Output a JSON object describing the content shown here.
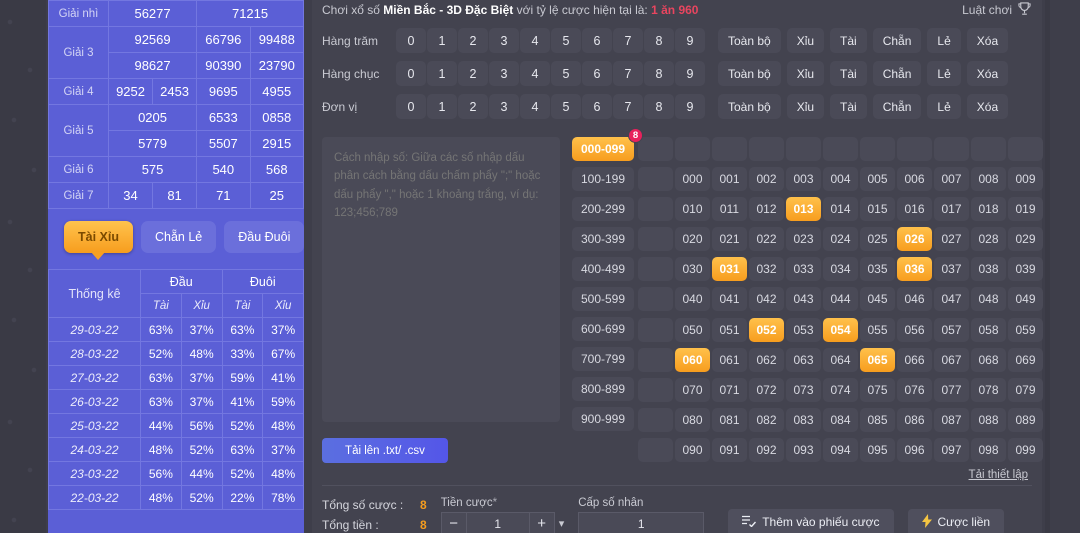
{
  "lottery_results": {
    "rows": [
      {
        "label": "Giải nhì",
        "cells": [
          {
            "t": "56277",
            "span": 2
          },
          {
            "t": "71215",
            "span": 2
          }
        ]
      },
      {
        "label": "Giải 3",
        "label_rowspan": 2,
        "cells": [
          {
            "t": "92569",
            "span": 2
          },
          {
            "t": "66796",
            "span": 1
          },
          {
            "t": "99488",
            "span": 1
          }
        ]
      },
      {
        "label": "",
        "cells": [
          {
            "t": "98627",
            "span": 2
          },
          {
            "t": "90390",
            "span": 1
          },
          {
            "t": "23790",
            "span": 1
          }
        ]
      },
      {
        "label": "Giải 4",
        "cells": [
          {
            "t": "9252",
            "span": 1
          },
          {
            "t": "2453",
            "span": 1
          },
          {
            "t": "9695",
            "span": 1
          },
          {
            "t": "4955",
            "span": 1
          }
        ]
      },
      {
        "label": "Giải 5",
        "label_rowspan": 2,
        "cells": [
          {
            "t": "0205",
            "span": 2
          },
          {
            "t": "6533",
            "span": 1
          },
          {
            "t": "0858",
            "span": 1
          }
        ]
      },
      {
        "label": "",
        "cells": [
          {
            "t": "5779",
            "span": 2
          },
          {
            "t": "5507",
            "span": 1
          },
          {
            "t": "2915",
            "span": 1
          }
        ]
      },
      {
        "label": "Giải 6",
        "cells": [
          {
            "t": "575",
            "span": 2
          },
          {
            "t": "540",
            "span": 1
          },
          {
            "t": "568",
            "span": 1
          }
        ]
      },
      {
        "label": "Giải 7",
        "cells": [
          {
            "t": "34",
            "span": 1
          },
          {
            "t": "81",
            "span": 1
          },
          {
            "t": "71",
            "span": 1
          },
          {
            "t": "25",
            "span": 1
          }
        ]
      }
    ]
  },
  "bet_tabs": [
    {
      "label": "Tài Xỉu",
      "active": true
    },
    {
      "label": "Chẵn Lẻ",
      "active": false
    },
    {
      "label": "Đầu Đuôi",
      "active": false
    }
  ],
  "stats": {
    "corner_label": "Thống kê",
    "group_headers": [
      "Đầu",
      "Đuôi"
    ],
    "sub_headers": [
      "Tài",
      "Xỉu",
      "Tài",
      "Xỉu"
    ],
    "rows": [
      {
        "date": "29-03-22",
        "values": [
          "63%",
          "37%",
          "63%",
          "37%"
        ]
      },
      {
        "date": "28-03-22",
        "values": [
          "52%",
          "48%",
          "33%",
          "67%"
        ]
      },
      {
        "date": "27-03-22",
        "values": [
          "63%",
          "37%",
          "59%",
          "41%"
        ]
      },
      {
        "date": "26-03-22",
        "values": [
          "63%",
          "37%",
          "41%",
          "59%"
        ]
      },
      {
        "date": "25-03-22",
        "values": [
          "44%",
          "56%",
          "52%",
          "48%"
        ]
      },
      {
        "date": "24-03-22",
        "values": [
          "48%",
          "52%",
          "63%",
          "37%"
        ]
      },
      {
        "date": "23-03-22",
        "values": [
          "56%",
          "44%",
          "52%",
          "48%"
        ]
      },
      {
        "date": "22-03-22",
        "values": [
          "48%",
          "52%",
          "22%",
          "78%"
        ]
      }
    ]
  },
  "header": {
    "prefix": "Chơi xổ số ",
    "game_name": "Miền Bắc - 3D Đặc Biệt",
    "middle": " với tỷ lệ cược hiện tại là: ",
    "odds": "1 ăn 960",
    "rules_label": "Luật chơi",
    "rules_icon": "trophy-icon"
  },
  "digit_rows": [
    {
      "label": "Hàng trăm",
      "digits": [
        "0",
        "1",
        "2",
        "3",
        "4",
        "5",
        "6",
        "7",
        "8",
        "9"
      ],
      "quick": [
        "Toàn bộ",
        "Xỉu",
        "Tài",
        "Chẵn",
        "Lẻ",
        "Xóa"
      ]
    },
    {
      "label": "Hàng chục",
      "digits": [
        "0",
        "1",
        "2",
        "3",
        "4",
        "5",
        "6",
        "7",
        "8",
        "9"
      ],
      "quick": [
        "Toàn bộ",
        "Xỉu",
        "Tài",
        "Chẵn",
        "Lẻ",
        "Xóa"
      ]
    },
    {
      "label": "Đơn vị",
      "digits": [
        "0",
        "1",
        "2",
        "3",
        "4",
        "5",
        "6",
        "7",
        "8",
        "9"
      ],
      "quick": [
        "Toàn bộ",
        "Xỉu",
        "Tài",
        "Chẵn",
        "Lẻ",
        "Xóa"
      ]
    }
  ],
  "bet_input": {
    "value": "",
    "placeholder": "Cách nhập số: Giữa các số nhập dấu phân cách bằng dấu chấm phẩy \";\" hoặc dấu phẩy \",\" hoặc 1 khoảng trắng, ví dụ: 123;456;789",
    "upload_label": "Tải lên .txt/ .csv"
  },
  "number_grid": {
    "range_tabs": [
      {
        "label": "000-099",
        "active": true,
        "badge": "8"
      },
      {
        "label": "100-199",
        "active": false,
        "badge": ""
      },
      {
        "label": "200-299",
        "active": false,
        "badge": ""
      },
      {
        "label": "300-399",
        "active": false,
        "badge": ""
      },
      {
        "label": "400-499",
        "active": false,
        "badge": ""
      },
      {
        "label": "500-599",
        "active": false,
        "badge": ""
      },
      {
        "label": "600-699",
        "active": false,
        "badge": ""
      },
      {
        "label": "700-799",
        "active": false,
        "badge": ""
      },
      {
        "label": "800-899",
        "active": false,
        "badge": ""
      },
      {
        "label": "900-999",
        "active": false,
        "badge": ""
      }
    ],
    "rows": [
      {
        "cells": [
          "",
          "",
          "",
          "",
          "",
          "",
          "",
          "",
          "",
          "",
          ""
        ]
      },
      {
        "cells": [
          "",
          "000",
          "001",
          "002",
          "003",
          "004",
          "005",
          "006",
          "007",
          "008",
          "009"
        ]
      },
      {
        "cells": [
          "",
          "010",
          "011",
          "012",
          "013",
          "014",
          "015",
          "016",
          "017",
          "018",
          "019"
        ]
      },
      {
        "cells": [
          "",
          "020",
          "021",
          "022",
          "023",
          "024",
          "025",
          "026",
          "027",
          "028",
          "029"
        ]
      },
      {
        "cells": [
          "",
          "030",
          "031",
          "032",
          "033",
          "034",
          "035",
          "036",
          "037",
          "038",
          "039"
        ]
      },
      {
        "cells": [
          "",
          "040",
          "041",
          "042",
          "043",
          "044",
          "045",
          "046",
          "047",
          "048",
          "049"
        ]
      },
      {
        "cells": [
          "",
          "050",
          "051",
          "052",
          "053",
          "054",
          "055",
          "056",
          "057",
          "058",
          "059"
        ]
      },
      {
        "cells": [
          "",
          "060",
          "061",
          "062",
          "063",
          "064",
          "065",
          "066",
          "067",
          "068",
          "069"
        ]
      },
      {
        "cells": [
          "",
          "070",
          "071",
          "072",
          "073",
          "074",
          "075",
          "076",
          "077",
          "078",
          "079"
        ]
      },
      {
        "cells": [
          "",
          "080",
          "081",
          "082",
          "083",
          "084",
          "085",
          "086",
          "087",
          "088",
          "089"
        ]
      },
      {
        "cells": [
          "",
          "090",
          "091",
          "092",
          "093",
          "094",
          "095",
          "096",
          "097",
          "098",
          "099"
        ]
      }
    ],
    "selected": [
      "013",
      "026",
      "031",
      "036",
      "052",
      "054",
      "060",
      "065"
    ]
  },
  "reset_link": "Tải thiết lập",
  "footer": {
    "total_bets_label": "Tổng số cược :",
    "total_bets_value": "8",
    "total_money_label": "Tổng tiền :",
    "total_money_value": "8",
    "stake_label": "Tiền cược",
    "stake_required": "*",
    "stake_value": "1",
    "stake_minus": "−",
    "stake_plus": "+",
    "multiplier_label": "Cấp số nhân",
    "multiplier_value": "1",
    "add_to_slip_label": "Thêm vào phiếu cược",
    "add_to_slip_icon": "list-check-icon",
    "quick_bet_label": "Cược liền",
    "quick_bet_icon": "lightning-icon"
  },
  "colors": {
    "accent_orange": "#f79d1e",
    "panel_blue": "#5b5fd6",
    "badge_red": "#e8215c",
    "odds_red": "#e8455f",
    "bg_dark": "#43434f"
  }
}
